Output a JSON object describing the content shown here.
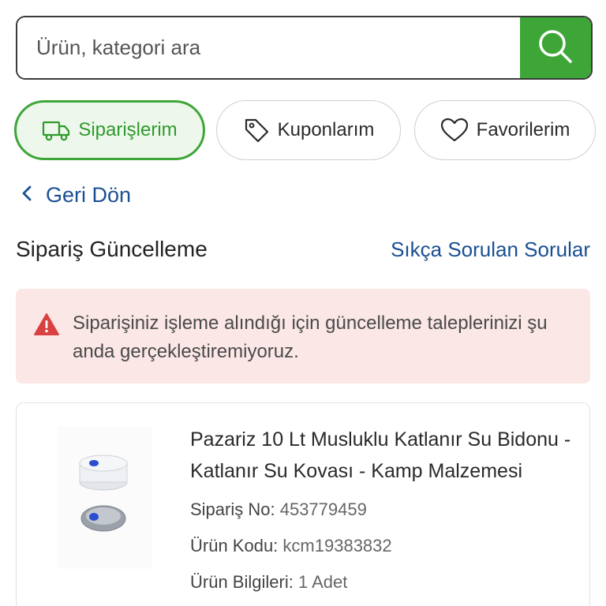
{
  "search": {
    "placeholder": "Ürün, kategori ara"
  },
  "chips": [
    {
      "label": "Siparişlerim",
      "icon": "truck-icon",
      "active": true
    },
    {
      "label": "Kuponlarım",
      "icon": "tag-icon",
      "active": false
    },
    {
      "label": "Favorilerim",
      "icon": "heart-icon",
      "active": false
    }
  ],
  "back": {
    "label": "Geri Dön"
  },
  "header": {
    "title": "Sipariş Güncelleme",
    "faq_link": "Sıkça Sorulan Sorular"
  },
  "alert": {
    "icon": "warning-icon",
    "text": "Siparişiniz işleme alındığı için güncelleme taleplerinizi şu anda gerçekleştiremiyoruz."
  },
  "product": {
    "title": "Pazariz 10 Lt Musluklu Katlanır Su Bidonu - Katlanır Su Kovası - Kamp Malzemesi",
    "order_no_label": "Sipariş No:",
    "order_no": "453779459",
    "product_code_label": "Ürün Kodu:",
    "product_code": "kcm19383832",
    "info_label": "Ürün Bilgileri:",
    "info": "1 Adet"
  },
  "colors": {
    "accent_green": "#3da637",
    "link_blue": "#1a4f93",
    "alert_bg": "#fbe7e6",
    "alert_icon": "#d94040"
  }
}
